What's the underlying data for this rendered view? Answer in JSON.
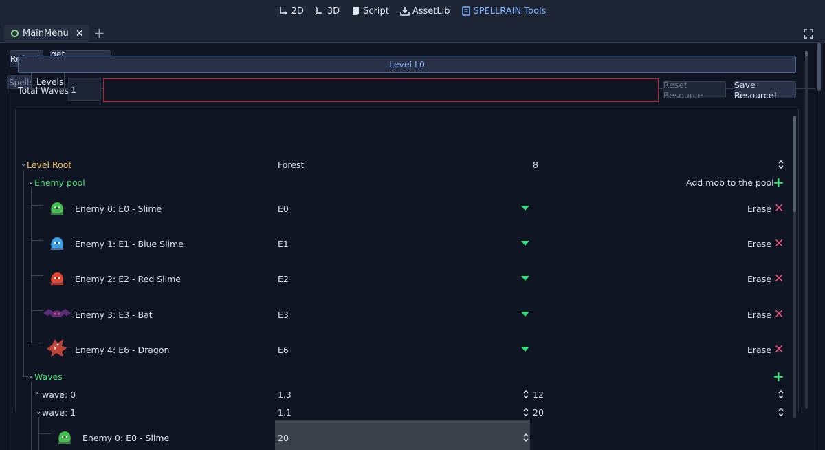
{
  "topbar": {
    "modes": [
      {
        "label": "2D",
        "icon": "2d-icon"
      },
      {
        "label": "3D",
        "icon": "3d-icon"
      },
      {
        "label": "Script",
        "icon": "script-icon"
      },
      {
        "label": "AssetLib",
        "icon": "assetlib-icon"
      },
      {
        "label": "SPELLRAIN Tools",
        "icon": "plugin-icon"
      }
    ]
  },
  "scene_tab": {
    "label": "MainMenu"
  },
  "toolbar": {
    "refresh": "Refresh",
    "translation": "get translation"
  },
  "tabs": {
    "spells": "Spells",
    "levels": "Levels"
  },
  "level": {
    "title": "Level L0",
    "total_waves_label": "Total Waves",
    "total_waves_value": "1",
    "reset_label": "Reset Resource",
    "save_label": "Save Resource!"
  },
  "tree": {
    "root": {
      "label": "Level Root",
      "biome": "Forest",
      "value": "8"
    },
    "enemy_pool": {
      "label": "Enemy pool",
      "add_label": "Add mob to the pool"
    },
    "enemies": [
      {
        "label": "Enemy 0: E0 - Slime",
        "id": "E0",
        "erase": "Erase",
        "color": "#3fc04a"
      },
      {
        "label": "Enemy 1: E1 - Blue Slime",
        "id": "E1",
        "erase": "Erase",
        "color": "#3aa2e8"
      },
      {
        "label": "Enemy 2: E2 - Red Slime",
        "id": "E2",
        "erase": "Erase",
        "color": "#e8452e"
      },
      {
        "label": "Enemy 3: E3 - Bat",
        "id": "E3",
        "erase": "Erase",
        "color": "#6a3a8a"
      },
      {
        "label": "Enemy 4: E6 - Dragon",
        "id": "E6",
        "erase": "Erase",
        "color": "#c0443a"
      }
    ],
    "waves": {
      "label": "Waves",
      "items": [
        {
          "label": "wave: 0",
          "a": "1.3",
          "b": "12"
        },
        {
          "label": "wave: 1",
          "a": "1.1",
          "b": "20"
        }
      ],
      "wave_enemy": {
        "label": "Enemy 0: E0 - Slime",
        "value": "20"
      }
    }
  }
}
